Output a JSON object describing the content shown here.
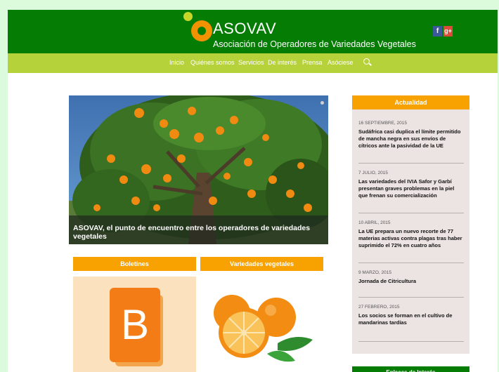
{
  "header": {
    "logo_title": "ASOVAV",
    "logo_subtitle": "Asociación de Operadores de Variedades Vegetales",
    "social": [
      {
        "icon": "facebook-icon",
        "label": "f"
      },
      {
        "icon": "google-plus-icon",
        "label": "g+"
      }
    ]
  },
  "nav": {
    "items": [
      "Inicio",
      "Quiénes somos",
      "Servicios",
      "De interés",
      "Prensa",
      "Asóciese"
    ],
    "search_icon": "search-icon"
  },
  "slider": {
    "caption": "ASOVAV, el punto de encuentro entre los operadores de variedades vegetales"
  },
  "boxes": {
    "boletines_title": "Boletines",
    "boletines_letter": "B",
    "variedades_title": "Variedades vegetales"
  },
  "sidebar": {
    "title": "Actualidad",
    "news": [
      {
        "date": "16 SEPTIEMBRE, 2015",
        "title": "Sudáfrica casi duplica el límite permitido de mancha negra en sus envíos de cítricos ante la pasividad de la UE"
      },
      {
        "date": "7 JULIO, 2015",
        "title": "Las variedades del IVIA Safor y Garbí presentan graves problemas en la piel que frenan su comercialización"
      },
      {
        "date": "10 ABRIL, 2015",
        "title": "La UE prepara un nuevo recorte de 77 materias activas contra plagas tras haber suprimido el 72% en cuatro años"
      },
      {
        "date": "9 MARZO, 2015",
        "title": "Jornada de Citricultura"
      },
      {
        "date": "27 FEBRERO, 2015",
        "title": "Los socios se forman en el cultivo de mandarinas tardías"
      }
    ],
    "links_title": "Enlaces de Interés"
  },
  "colors": {
    "header_green": "#057d05",
    "nav_lime": "#b6d23a",
    "accent_orange": "#f7a200",
    "page_bg": "#dcfadc"
  }
}
